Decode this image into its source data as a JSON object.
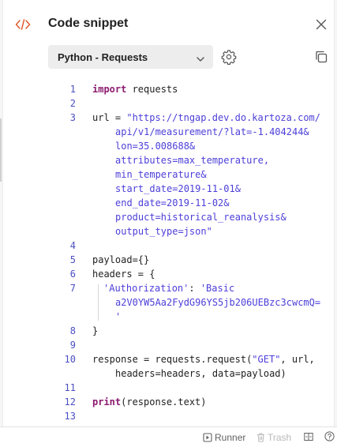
{
  "header": {
    "title": "Code snippet"
  },
  "toolbar": {
    "language": "Python - Requests"
  },
  "code": {
    "line_numbers": [
      "1",
      "2",
      "3",
      "4",
      "5",
      "6",
      "7",
      "8",
      "9",
      "10",
      "11",
      "12",
      "13"
    ],
    "l1_keyword": "import",
    "l1_rest": " requests",
    "l3_var": "url = ",
    "url_parts": [
      "\"https://tngap.dev.do.kartoza.com/",
      "api/v1/measurement/?lat=-1.404244&",
      "lon=35.008688&",
      "attributes=max_temperature,",
      "min_temperature&",
      "start_date=2019-11-01&",
      "end_date=2019-11-02&",
      "product=historical_reanalysis&",
      "output_type=json\""
    ],
    "l5": "payload={}",
    "l6": "headers = {",
    "l7_key": "'Authorization'",
    "l7_colon": ": ",
    "l7_val_parts": [
      "'Basic",
      "a2V0YW5Aa2FydG96YS5jb206UEBzc3cwcmQ=",
      "'"
    ],
    "l8": "}",
    "l10_a": "response = requests.request(",
    "l10_str": "\"GET\"",
    "l10_b": ", url,",
    "l10_cont": "headers=headers, data=payload)",
    "l12_keyword": "print",
    "l12_rest": "(response.text)"
  },
  "footer": {
    "runner": "Runner",
    "trash": "Trash"
  },
  "colors": {
    "keyword": "#8b1c6f",
    "string": "#4c3fd8",
    "line_number": "#4b4fbf",
    "accent": "#e0592a"
  },
  "icons": [
    "code-icon",
    "close-icon",
    "chevron-down-icon",
    "gear-icon",
    "copy-icon",
    "runner-icon",
    "trash-icon",
    "two-pane-icon",
    "help-icon"
  ]
}
